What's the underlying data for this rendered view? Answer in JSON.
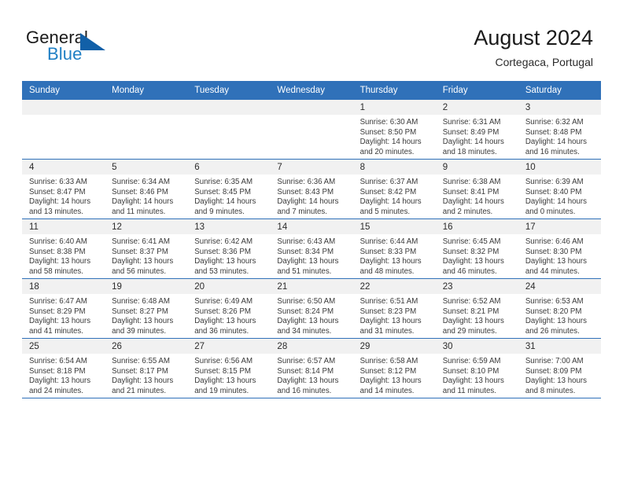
{
  "brand": {
    "name_part1": "General",
    "name_part2": "Blue",
    "triangle_color": "#1260a8",
    "blue_color": "#1f7fc4"
  },
  "header": {
    "title": "August 2024",
    "location": "Cortegaca, Portugal"
  },
  "theme": {
    "header_band": "#3071b9",
    "daynum_band": "#f1f1f1",
    "text": "#3a3a3a"
  },
  "weekday_headers": [
    "Sunday",
    "Monday",
    "Tuesday",
    "Wednesday",
    "Thursday",
    "Friday",
    "Saturday"
  ],
  "weeks": [
    [
      {
        "day": "",
        "empty": true
      },
      {
        "day": "",
        "empty": true
      },
      {
        "day": "",
        "empty": true
      },
      {
        "day": "",
        "empty": true
      },
      {
        "day": "1",
        "sunrise": "Sunrise: 6:30 AM",
        "sunset": "Sunset: 8:50 PM",
        "daylight1": "Daylight: 14 hours",
        "daylight2": "and 20 minutes."
      },
      {
        "day": "2",
        "sunrise": "Sunrise: 6:31 AM",
        "sunset": "Sunset: 8:49 PM",
        "daylight1": "Daylight: 14 hours",
        "daylight2": "and 18 minutes."
      },
      {
        "day": "3",
        "sunrise": "Sunrise: 6:32 AM",
        "sunset": "Sunset: 8:48 PM",
        "daylight1": "Daylight: 14 hours",
        "daylight2": "and 16 minutes."
      }
    ],
    [
      {
        "day": "4",
        "sunrise": "Sunrise: 6:33 AM",
        "sunset": "Sunset: 8:47 PM",
        "daylight1": "Daylight: 14 hours",
        "daylight2": "and 13 minutes."
      },
      {
        "day": "5",
        "sunrise": "Sunrise: 6:34 AM",
        "sunset": "Sunset: 8:46 PM",
        "daylight1": "Daylight: 14 hours",
        "daylight2": "and 11 minutes."
      },
      {
        "day": "6",
        "sunrise": "Sunrise: 6:35 AM",
        "sunset": "Sunset: 8:45 PM",
        "daylight1": "Daylight: 14 hours",
        "daylight2": "and 9 minutes."
      },
      {
        "day": "7",
        "sunrise": "Sunrise: 6:36 AM",
        "sunset": "Sunset: 8:43 PM",
        "daylight1": "Daylight: 14 hours",
        "daylight2": "and 7 minutes."
      },
      {
        "day": "8",
        "sunrise": "Sunrise: 6:37 AM",
        "sunset": "Sunset: 8:42 PM",
        "daylight1": "Daylight: 14 hours",
        "daylight2": "and 5 minutes."
      },
      {
        "day": "9",
        "sunrise": "Sunrise: 6:38 AM",
        "sunset": "Sunset: 8:41 PM",
        "daylight1": "Daylight: 14 hours",
        "daylight2": "and 2 minutes."
      },
      {
        "day": "10",
        "sunrise": "Sunrise: 6:39 AM",
        "sunset": "Sunset: 8:40 PM",
        "daylight1": "Daylight: 14 hours",
        "daylight2": "and 0 minutes."
      }
    ],
    [
      {
        "day": "11",
        "sunrise": "Sunrise: 6:40 AM",
        "sunset": "Sunset: 8:38 PM",
        "daylight1": "Daylight: 13 hours",
        "daylight2": "and 58 minutes."
      },
      {
        "day": "12",
        "sunrise": "Sunrise: 6:41 AM",
        "sunset": "Sunset: 8:37 PM",
        "daylight1": "Daylight: 13 hours",
        "daylight2": "and 56 minutes."
      },
      {
        "day": "13",
        "sunrise": "Sunrise: 6:42 AM",
        "sunset": "Sunset: 8:36 PM",
        "daylight1": "Daylight: 13 hours",
        "daylight2": "and 53 minutes."
      },
      {
        "day": "14",
        "sunrise": "Sunrise: 6:43 AM",
        "sunset": "Sunset: 8:34 PM",
        "daylight1": "Daylight: 13 hours",
        "daylight2": "and 51 minutes."
      },
      {
        "day": "15",
        "sunrise": "Sunrise: 6:44 AM",
        "sunset": "Sunset: 8:33 PM",
        "daylight1": "Daylight: 13 hours",
        "daylight2": "and 48 minutes."
      },
      {
        "day": "16",
        "sunrise": "Sunrise: 6:45 AM",
        "sunset": "Sunset: 8:32 PM",
        "daylight1": "Daylight: 13 hours",
        "daylight2": "and 46 minutes."
      },
      {
        "day": "17",
        "sunrise": "Sunrise: 6:46 AM",
        "sunset": "Sunset: 8:30 PM",
        "daylight1": "Daylight: 13 hours",
        "daylight2": "and 44 minutes."
      }
    ],
    [
      {
        "day": "18",
        "sunrise": "Sunrise: 6:47 AM",
        "sunset": "Sunset: 8:29 PM",
        "daylight1": "Daylight: 13 hours",
        "daylight2": "and 41 minutes."
      },
      {
        "day": "19",
        "sunrise": "Sunrise: 6:48 AM",
        "sunset": "Sunset: 8:27 PM",
        "daylight1": "Daylight: 13 hours",
        "daylight2": "and 39 minutes."
      },
      {
        "day": "20",
        "sunrise": "Sunrise: 6:49 AM",
        "sunset": "Sunset: 8:26 PM",
        "daylight1": "Daylight: 13 hours",
        "daylight2": "and 36 minutes."
      },
      {
        "day": "21",
        "sunrise": "Sunrise: 6:50 AM",
        "sunset": "Sunset: 8:24 PM",
        "daylight1": "Daylight: 13 hours",
        "daylight2": "and 34 minutes."
      },
      {
        "day": "22",
        "sunrise": "Sunrise: 6:51 AM",
        "sunset": "Sunset: 8:23 PM",
        "daylight1": "Daylight: 13 hours",
        "daylight2": "and 31 minutes."
      },
      {
        "day": "23",
        "sunrise": "Sunrise: 6:52 AM",
        "sunset": "Sunset: 8:21 PM",
        "daylight1": "Daylight: 13 hours",
        "daylight2": "and 29 minutes."
      },
      {
        "day": "24",
        "sunrise": "Sunrise: 6:53 AM",
        "sunset": "Sunset: 8:20 PM",
        "daylight1": "Daylight: 13 hours",
        "daylight2": "and 26 minutes."
      }
    ],
    [
      {
        "day": "25",
        "sunrise": "Sunrise: 6:54 AM",
        "sunset": "Sunset: 8:18 PM",
        "daylight1": "Daylight: 13 hours",
        "daylight2": "and 24 minutes."
      },
      {
        "day": "26",
        "sunrise": "Sunrise: 6:55 AM",
        "sunset": "Sunset: 8:17 PM",
        "daylight1": "Daylight: 13 hours",
        "daylight2": "and 21 minutes."
      },
      {
        "day": "27",
        "sunrise": "Sunrise: 6:56 AM",
        "sunset": "Sunset: 8:15 PM",
        "daylight1": "Daylight: 13 hours",
        "daylight2": "and 19 minutes."
      },
      {
        "day": "28",
        "sunrise": "Sunrise: 6:57 AM",
        "sunset": "Sunset: 8:14 PM",
        "daylight1": "Daylight: 13 hours",
        "daylight2": "and 16 minutes."
      },
      {
        "day": "29",
        "sunrise": "Sunrise: 6:58 AM",
        "sunset": "Sunset: 8:12 PM",
        "daylight1": "Daylight: 13 hours",
        "daylight2": "and 14 minutes."
      },
      {
        "day": "30",
        "sunrise": "Sunrise: 6:59 AM",
        "sunset": "Sunset: 8:10 PM",
        "daylight1": "Daylight: 13 hours",
        "daylight2": "and 11 minutes."
      },
      {
        "day": "31",
        "sunrise": "Sunrise: 7:00 AM",
        "sunset": "Sunset: 8:09 PM",
        "daylight1": "Daylight: 13 hours",
        "daylight2": "and 8 minutes."
      }
    ]
  ]
}
